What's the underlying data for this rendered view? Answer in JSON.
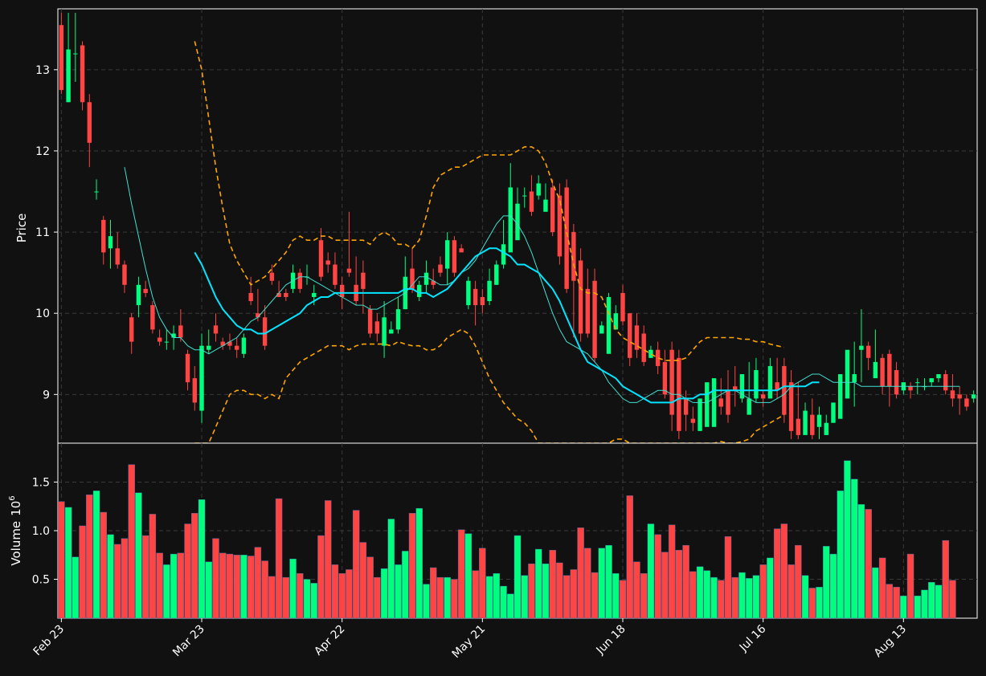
{
  "chart_data": {
    "type": "candlestick",
    "title": "",
    "dates_start": "Feb 23",
    "x_tick_labels": [
      "Feb 23",
      "Mar 23",
      "Apr 22",
      "May 21",
      "Jun 18",
      "Jul 16",
      "Aug 13"
    ],
    "price_panel": {
      "ylabel": "Price",
      "ylim": [
        8.4,
        13.75
      ],
      "y_ticks": [
        9,
        10,
        11,
        12,
        13
      ],
      "up_color": "#00ff7f",
      "down_color": "#ff4444"
    },
    "volume_panel": {
      "ylabel": "Volume",
      "ylabel_multiplier": "10",
      "ylabel_exponent": "6",
      "ylim": [
        0.1,
        1.9
      ],
      "y_ticks": [
        0.5,
        1.0,
        1.5
      ],
      "y_tick_labels": [
        "0.5",
        "1.0",
        "1.5"
      ]
    },
    "overlays": [
      {
        "name": "",
        "color": "#40e0d0",
        "style": "solid-thin"
      },
      {
        "name": "",
        "color": "#00e5ff",
        "style": "solid-thick"
      },
      {
        "name": "",
        "color": "#ffa500",
        "style": "dashed"
      }
    ],
    "grid": true,
    "tick_positions": [
      0,
      20,
      40,
      60,
      80,
      100,
      120
    ],
    "open": [
      13.55,
      12.6,
      13.2,
      13.3,
      12.6,
      11.5,
      11.15,
      10.8,
      10.8,
      10.6,
      9.95,
      10.1,
      10.3,
      10.1,
      9.7,
      9.65,
      9.7,
      9.85,
      9.5,
      9.2,
      8.8,
      9.55,
      9.85,
      9.65,
      9.65,
      9.6,
      9.5,
      10.25,
      10.0,
      9.95,
      10.5,
      10.25,
      10.25,
      10.3,
      10.5,
      10.45,
      10.2,
      10.9,
      10.65,
      10.6,
      10.35,
      10.55,
      10.35,
      10.5,
      10.05,
      9.9,
      9.6,
      9.75,
      9.8,
      10.05,
      10.55,
      10.2,
      10.35,
      10.4,
      10.6,
      10.55,
      10.9,
      10.8,
      10.1,
      10.3,
      10.2,
      10.15,
      10.35,
      10.6,
      10.75,
      10.9,
      11.45,
      11.5,
      11.45,
      11.25,
      11.55,
      11.45,
      11.55,
      11.0,
      10.65,
      10.3,
      10.4,
      9.75,
      9.5,
      9.8,
      10.25,
      10.0,
      9.85,
      9.75,
      9.45,
      9.55,
      9.4,
      9.55,
      9.45,
      8.95,
      8.7,
      8.55,
      8.6,
      8.6,
      8.95,
      9.05,
      9.1,
      8.95,
      8.75,
      8.95,
      9.0,
      8.95,
      9.15,
      9.35,
      9.15,
      8.7,
      8.5,
      8.75,
      8.6,
      8.5,
      8.65,
      8.7,
      8.95,
      9.15,
      9.55,
      9.6,
      9.2,
      9.45,
      9.5,
      9.3,
      9.05,
      9.1,
      9.15,
      9.1,
      9.15,
      9.2,
      9.25,
      9.05,
      9.0,
      8.95,
      8.95
    ],
    "close": [
      12.75,
      13.25,
      13.2,
      12.6,
      12.1,
      11.5,
      10.75,
      10.95,
      10.6,
      10.35,
      9.65,
      10.35,
      10.25,
      9.8,
      9.65,
      9.65,
      9.75,
      9.7,
      9.15,
      8.9,
      9.6,
      9.6,
      9.75,
      9.6,
      9.6,
      9.55,
      9.7,
      10.15,
      9.95,
      9.6,
      10.4,
      10.2,
      10.2,
      10.5,
      10.3,
      10.45,
      10.25,
      10.45,
      10.6,
      10.35,
      10.2,
      10.5,
      10.15,
      10.3,
      9.75,
      9.75,
      9.95,
      9.8,
      10.05,
      10.45,
      10.3,
      10.35,
      10.5,
      10.35,
      10.5,
      10.9,
      10.5,
      10.75,
      10.4,
      10.1,
      10.1,
      10.4,
      10.6,
      10.85,
      11.55,
      11.35,
      11.45,
      11.25,
      11.6,
      11.4,
      11.0,
      10.7,
      10.3,
      10.4,
      9.75,
      9.75,
      9.45,
      9.85,
      10.2,
      10.0,
      9.9,
      9.45,
      9.55,
      9.4,
      9.55,
      9.35,
      9.0,
      8.75,
      8.55,
      8.75,
      8.65,
      8.95,
      9.15,
      9.2,
      8.85,
      8.75,
      9.05,
      9.25,
      8.95,
      9.3,
      8.95,
      9.35,
      9.05,
      8.75,
      8.55,
      8.5,
      8.8,
      8.5,
      8.75,
      8.65,
      8.9,
      9.25,
      9.55,
      9.25,
      9.6,
      9.45,
      9.4,
      9.1,
      9.1,
      9.0,
      9.15,
      9.05,
      9.15,
      9.1,
      9.2,
      9.25,
      9.05,
      8.95,
      8.95,
      8.85,
      9.0
    ],
    "high": [
      13.7,
      13.7,
      13.7,
      13.35,
      12.7,
      11.65,
      11.2,
      11.15,
      11.0,
      10.65,
      10.0,
      10.45,
      10.4,
      10.15,
      9.8,
      9.8,
      9.85,
      10.05,
      9.55,
      9.35,
      9.75,
      9.8,
      10.0,
      9.7,
      9.75,
      9.7,
      9.75,
      10.45,
      10.3,
      10.1,
      10.6,
      10.4,
      10.3,
      10.6,
      10.55,
      10.6,
      10.35,
      11.05,
      10.75,
      10.75,
      10.45,
      11.25,
      10.7,
      10.65,
      10.1,
      10.0,
      10.15,
      9.9,
      10.2,
      10.7,
      10.8,
      10.4,
      10.65,
      10.55,
      10.7,
      11.0,
      10.95,
      10.85,
      10.45,
      10.4,
      10.3,
      10.55,
      10.65,
      11.15,
      11.85,
      11.55,
      11.55,
      11.7,
      11.7,
      11.6,
      11.65,
      11.6,
      11.65,
      11.1,
      10.8,
      10.55,
      10.55,
      9.9,
      10.25,
      10.1,
      10.35,
      10.0,
      10.0,
      9.85,
      9.6,
      9.65,
      9.55,
      9.65,
      9.55,
      9.05,
      8.85,
      8.75,
      8.8,
      8.85,
      9.2,
      9.3,
      9.35,
      9.05,
      9.4,
      9.45,
      9.05,
      9.45,
      9.45,
      9.45,
      9.3,
      9.15,
      8.9,
      8.95,
      8.85,
      8.75,
      8.9,
      8.95,
      9.4,
      9.65,
      10.05,
      9.65,
      9.8,
      9.5,
      9.55,
      9.4,
      9.15,
      9.15,
      9.2,
      9.2,
      9.2,
      9.25,
      9.3,
      9.25,
      9.1,
      9.0,
      9.05,
      8.95,
      9.1
    ],
    "low": [
      12.7,
      12.6,
      12.85,
      12.5,
      11.8,
      11.4,
      10.6,
      10.55,
      10.55,
      10.25,
      9.5,
      9.95,
      10.2,
      9.75,
      9.6,
      9.55,
      9.55,
      9.65,
      9.05,
      8.8,
      8.65,
      9.5,
      9.65,
      9.55,
      9.55,
      9.45,
      9.45,
      10.1,
      9.9,
      9.55,
      10.35,
      10.2,
      10.15,
      10.25,
      10.25,
      10.35,
      10.1,
      10.4,
      10.5,
      10.3,
      10.05,
      10.45,
      10.1,
      10.0,
      9.7,
      9.65,
      9.45,
      9.75,
      9.75,
      10.05,
      10.25,
      10.15,
      10.25,
      10.3,
      10.45,
      10.35,
      10.45,
      10.75,
      10.05,
      9.85,
      10.0,
      10.1,
      10.35,
      10.55,
      10.9,
      11.3,
      11.3,
      11.2,
      11.4,
      11.3,
      10.95,
      10.6,
      10.25,
      9.7,
      9.65,
      9.7,
      9.4,
      9.75,
      9.95,
      9.9,
      9.85,
      9.35,
      9.45,
      9.35,
      9.45,
      9.25,
      8.95,
      8.55,
      8.45,
      8.55,
      8.55,
      8.55,
      9.05,
      8.9,
      8.75,
      8.65,
      8.85,
      8.9,
      8.9,
      8.9,
      8.85,
      9.05,
      8.95,
      8.65,
      8.45,
      8.45,
      8.55,
      8.45,
      8.45,
      8.5,
      8.7,
      8.95,
      9.3,
      8.85,
      9.15,
      9.3,
      9.3,
      9.0,
      8.85,
      8.95,
      9.0,
      8.95,
      9.0,
      9.05,
      9.1,
      9.15,
      9.0,
      8.85,
      8.75,
      8.8,
      8.9
    ],
    "volume": [
      1.3,
      1.24,
      0.73,
      1.05,
      1.37,
      1.41,
      1.19,
      0.96,
      0.86,
      0.92,
      1.68,
      1.39,
      0.95,
      1.17,
      0.77,
      0.65,
      0.76,
      0.77,
      1.07,
      1.18,
      1.32,
      0.68,
      0.92,
      0.77,
      0.76,
      0.75,
      0.75,
      0.74,
      0.83,
      0.69,
      0.53,
      1.33,
      0.52,
      0.71,
      0.56,
      0.5,
      0.46,
      0.95,
      1.31,
      0.65,
      0.56,
      0.6,
      1.21,
      0.88,
      0.73,
      0.52,
      0.61,
      1.12,
      0.65,
      0.79,
      1.18,
      1.23,
      0.45,
      0.62,
      0.52,
      0.52,
      0.5,
      1.01,
      0.97,
      0.59,
      0.82,
      0.53,
      0.56,
      0.43,
      0.35,
      0.95,
      0.54,
      0.66,
      0.81,
      0.66,
      0.8,
      0.67,
      0.54,
      0.6,
      1.03,
      0.82,
      0.57,
      0.82,
      0.85,
      0.56,
      0.49,
      1.36,
      0.68,
      0.56,
      1.07,
      0.96,
      0.78,
      1.06,
      0.8,
      0.85,
      0.58,
      0.63,
      0.59,
      0.52,
      0.49,
      0.94,
      0.52,
      0.57,
      0.51,
      0.54,
      0.65,
      0.72,
      1.02,
      1.07,
      0.65,
      0.85,
      0.54,
      0.41,
      0.42,
      0.84,
      0.76,
      1.41,
      1.72,
      1.53,
      1.27,
      1.22,
      0.62,
      0.72,
      0.45,
      0.42,
      0.33,
      0.76,
      0.33,
      0.39,
      0.47,
      0.44,
      0.9,
      0.49
    ],
    "ma_fast": [
      null,
      null,
      null,
      null,
      null,
      null,
      null,
      null,
      null,
      11.8,
      11.35,
      10.95,
      10.55,
      10.2,
      9.95,
      9.8,
      9.7,
      9.7,
      9.6,
      9.55,
      9.55,
      9.5,
      9.55,
      9.6,
      9.65,
      9.7,
      9.8,
      9.9,
      9.95,
      10.05,
      10.15,
      10.25,
      10.35,
      10.4,
      10.45,
      10.45,
      10.4,
      10.35,
      10.3,
      10.25,
      10.2,
      10.15,
      10.1,
      10.1,
      10.05,
      10.05,
      10.1,
      10.15,
      10.2,
      10.25,
      10.35,
      10.45,
      10.45,
      10.4,
      10.35,
      10.35,
      10.4,
      10.5,
      10.55,
      10.65,
      10.8,
      10.95,
      11.1,
      11.2,
      11.2,
      11.1,
      10.95,
      10.75,
      10.5,
      10.25,
      10.0,
      9.8,
      9.65,
      9.6,
      9.55,
      9.5,
      9.4,
      9.3,
      9.15,
      9.05,
      8.95,
      8.9,
      8.9,
      8.95,
      9.0,
      9.05,
      9.05,
      9.0,
      9.0,
      8.95,
      8.9,
      8.9,
      8.9,
      8.95,
      9.0,
      9.05,
      9.05,
      9.0,
      8.95,
      8.9,
      8.9,
      8.9,
      8.95,
      9.0,
      9.1,
      9.15,
      9.2,
      9.25,
      9.25,
      9.2,
      9.15,
      9.15,
      9.15,
      9.15,
      9.1,
      9.1,
      9.1,
      9.1,
      9.1,
      9.1,
      9.1,
      9.1,
      9.1,
      9.1,
      9.1,
      9.1,
      9.1,
      9.1,
      9.1
    ],
    "ma_slow": [
      null,
      null,
      null,
      null,
      null,
      null,
      null,
      null,
      null,
      null,
      null,
      null,
      null,
      null,
      null,
      null,
      null,
      null,
      null,
      10.75,
      10.6,
      10.4,
      10.2,
      10.05,
      9.95,
      9.85,
      9.8,
      9.8,
      9.75,
      9.75,
      9.8,
      9.85,
      9.9,
      9.95,
      10.0,
      10.1,
      10.15,
      10.2,
      10.2,
      10.25,
      10.25,
      10.25,
      10.25,
      10.25,
      10.25,
      10.25,
      10.25,
      10.25,
      10.25,
      10.3,
      10.3,
      10.25,
      10.25,
      10.2,
      10.25,
      10.3,
      10.4,
      10.5,
      10.6,
      10.7,
      10.75,
      10.8,
      10.8,
      10.75,
      10.7,
      10.6,
      10.6,
      10.55,
      10.5,
      10.4,
      10.3,
      10.15,
      9.95,
      9.75,
      9.55,
      9.4,
      9.35,
      9.3,
      9.25,
      9.2,
      9.1,
      9.05,
      9.0,
      8.95,
      8.9,
      8.9,
      8.9,
      8.9,
      8.95,
      8.95,
      8.95,
      9.0,
      9.0,
      9.05,
      9.05,
      9.05,
      9.05,
      9.05,
      9.05,
      9.05,
      9.05,
      9.05,
      9.05,
      9.1,
      9.1,
      9.1,
      9.1,
      9.15,
      9.15
    ],
    "bb_upper": [
      null,
      null,
      null,
      null,
      null,
      null,
      null,
      null,
      null,
      null,
      null,
      null,
      null,
      null,
      null,
      null,
      null,
      null,
      null,
      13.35,
      13.0,
      12.4,
      11.8,
      11.3,
      10.85,
      10.65,
      10.5,
      10.35,
      10.4,
      10.45,
      10.55,
      10.65,
      10.75,
      10.9,
      10.95,
      10.9,
      10.9,
      10.95,
      10.95,
      10.9,
      10.9,
      10.9,
      10.9,
      10.9,
      10.85,
      10.95,
      11.0,
      10.95,
      10.85,
      10.85,
      10.8,
      10.9,
      11.2,
      11.55,
      11.7,
      11.75,
      11.8,
      11.8,
      11.85,
      11.9,
      11.95,
      11.95,
      11.95,
      11.95,
      11.95,
      12.0,
      12.05,
      12.05,
      12.0,
      11.85,
      11.6,
      11.4,
      11.0,
      10.6,
      10.3,
      10.25,
      10.25,
      10.2,
      10.0,
      9.8,
      9.7,
      9.65,
      9.6,
      9.55,
      9.5,
      9.45,
      9.42,
      9.42,
      9.42,
      9.45,
      9.55,
      9.65,
      9.7,
      9.7,
      9.7,
      9.7,
      9.7,
      9.68,
      9.68,
      9.65,
      9.65,
      9.62,
      9.6,
      9.58
    ],
    "bb_lower": [
      null,
      null,
      null,
      null,
      null,
      null,
      null,
      null,
      null,
      null,
      null,
      null,
      null,
      null,
      null,
      null,
      null,
      null,
      null,
      8.1,
      8.2,
      8.4,
      8.6,
      8.8,
      9.0,
      9.05,
      9.05,
      9.0,
      9.0,
      8.95,
      9.0,
      8.95,
      9.2,
      9.3,
      9.4,
      9.45,
      9.5,
      9.55,
      9.6,
      9.6,
      9.6,
      9.55,
      9.6,
      9.62,
      9.62,
      9.62,
      9.62,
      9.6,
      9.65,
      9.62,
      9.6,
      9.6,
      9.55,
      9.55,
      9.6,
      9.7,
      9.75,
      9.8,
      9.75,
      9.6,
      9.4,
      9.2,
      9.05,
      8.9,
      8.8,
      8.7,
      8.65,
      8.55,
      8.4,
      8.3,
      8.25,
      8.3,
      8.35,
      8.3,
      8.25,
      8.15,
      8.0,
      8.05,
      8.3,
      8.45,
      8.45,
      8.4,
      8.35,
      8.3,
      8.3,
      8.3,
      8.35,
      8.4,
      8.38,
      8.35,
      8.3,
      8.35,
      8.35,
      8.4,
      8.42,
      8.4,
      8.4,
      8.42,
      8.45,
      8.55,
      8.6,
      8.65,
      8.7,
      8.75
    ]
  }
}
